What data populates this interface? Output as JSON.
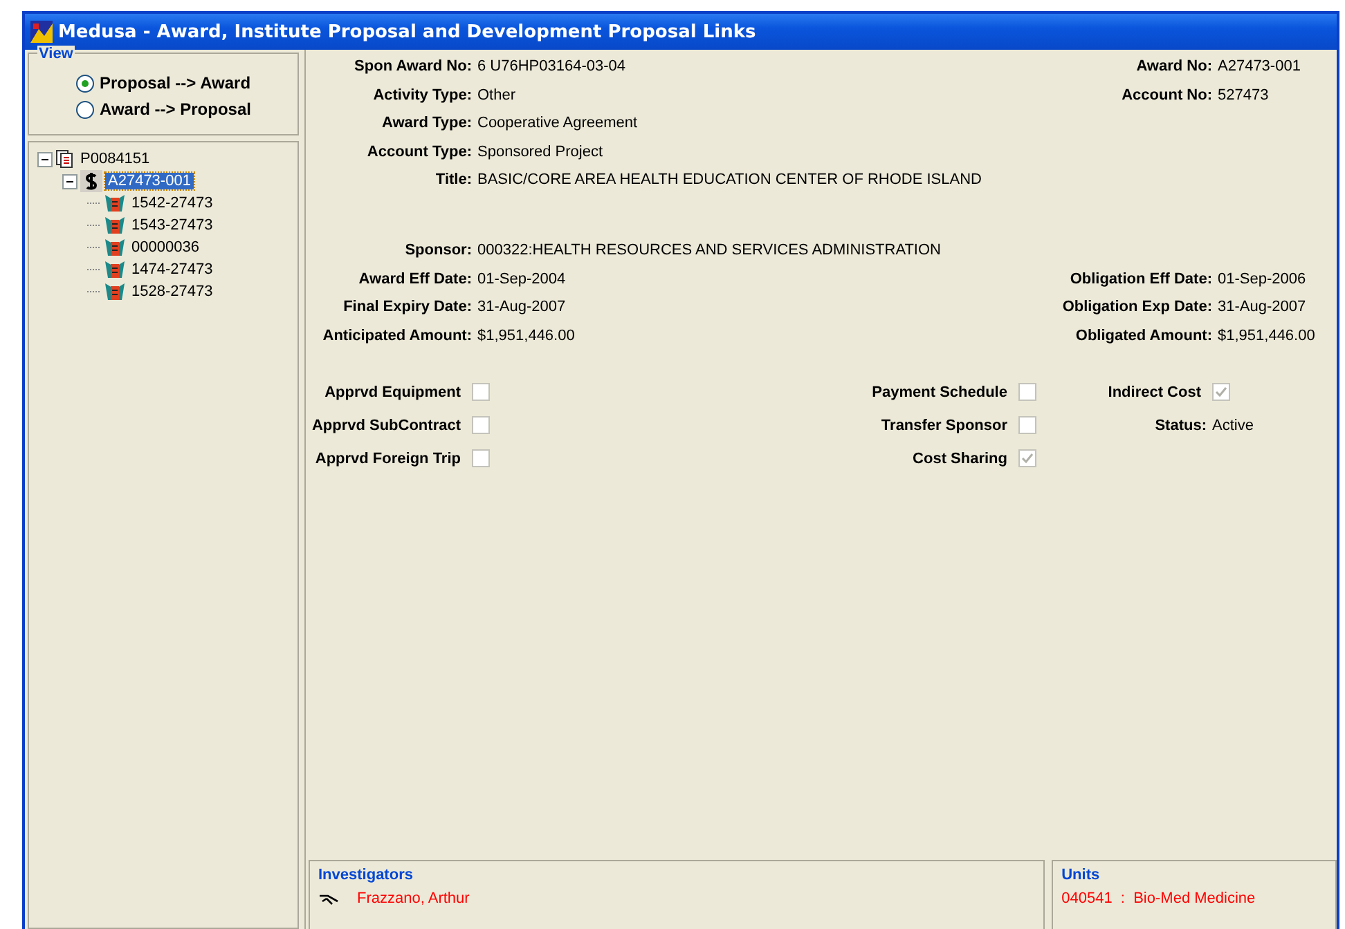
{
  "window": {
    "title": "Medusa - Award, Institute Proposal and Development Proposal Links"
  },
  "view": {
    "legend": "View",
    "options": [
      {
        "label": "Proposal --> Award",
        "selected": true
      },
      {
        "label": "Award --> Proposal",
        "selected": false
      }
    ]
  },
  "tree": [
    {
      "kind": "proposal",
      "label": "P0084151",
      "expanded": true,
      "selected": false,
      "children": [
        {
          "kind": "award",
          "label": "A27473-001",
          "expanded": true,
          "selected": true,
          "children": [
            {
              "kind": "development",
              "label": "1542-27473",
              "selected": false
            },
            {
              "kind": "development",
              "label": "1543-27473",
              "selected": false
            },
            {
              "kind": "development",
              "label": "00000036",
              "selected": false
            },
            {
              "kind": "development",
              "label": "1474-27473",
              "selected": false
            },
            {
              "kind": "development",
              "label": "1528-27473",
              "selected": false
            }
          ]
        }
      ]
    }
  ],
  "details": [
    {
      "left": {
        "label": "Spon Award No:",
        "value": "6 U76HP03164-03-04"
      },
      "right": {
        "label": "Award No:",
        "value": "A27473-001"
      }
    },
    {
      "left": {
        "label": "Activity Type:",
        "value": "Other"
      },
      "right": {
        "label": "Account No:",
        "value": "527473"
      }
    },
    {
      "left": {
        "label": "Award Type:",
        "value": "Cooperative Agreement"
      }
    },
    {
      "left": {
        "label": "Account Type:",
        "value": "Sponsored Project"
      }
    },
    {
      "left": {
        "label": "Title:",
        "value": "BASIC/CORE AREA HEALTH EDUCATION CENTER OF RHODE ISLAND"
      },
      "tall": true
    },
    {
      "left": {
        "label": "Sponsor:",
        "value": "000322:HEALTH RESOURCES AND SERVICES ADMINISTRATION"
      }
    },
    {
      "left": {
        "label": "Award Eff Date:",
        "value": "01-Sep-2004"
      },
      "right": {
        "label": "Obligation Eff Date:",
        "value": "01-Sep-2006"
      }
    },
    {
      "left": {
        "label": "Final Expiry Date:",
        "value": "31-Aug-2007"
      },
      "right": {
        "label": "Obligation Exp Date:",
        "value": "31-Aug-2007"
      }
    },
    {
      "left": {
        "label": "Anticipated Amount:",
        "value": "$1,951,446.00"
      },
      "right": {
        "label": "Obligated Amount:",
        "value": "$1,951,446.00"
      }
    }
  ],
  "flags": [
    [
      {
        "kind": "checkbox",
        "label": "Apprvd Equipment",
        "checked": false
      },
      {
        "kind": "checkbox",
        "label": "Payment Schedule",
        "checked": false
      },
      {
        "kind": "checkbox",
        "label": "Indirect Cost",
        "checked": true
      }
    ],
    [
      {
        "kind": "checkbox",
        "label": "Apprvd SubContract",
        "checked": false
      },
      {
        "kind": "checkbox",
        "label": "Transfer Sponsor",
        "checked": false
      },
      {
        "kind": "field",
        "label": "Status:",
        "value": "Active"
      }
    ],
    [
      {
        "kind": "checkbox",
        "label": "Apprvd Foreign Trip",
        "checked": false
      },
      {
        "kind": "checkbox",
        "label": "Cost Sharing",
        "checked": true
      }
    ]
  ],
  "investigators": {
    "title": "Investigators",
    "items": [
      "Frazzano, Arthur"
    ]
  },
  "units": {
    "title": "Units",
    "items": [
      "040541  :  Bio-Med Medicine"
    ]
  }
}
